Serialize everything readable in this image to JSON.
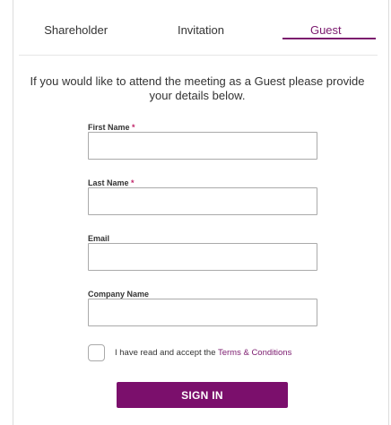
{
  "tabs": [
    {
      "label": "Shareholder",
      "active": false
    },
    {
      "label": "Invitation",
      "active": false
    },
    {
      "label": "Guest",
      "active": true
    }
  ],
  "intro": "If you would like to attend the meeting as a Guest please provide your details below.",
  "form": {
    "first_name": {
      "label": "First Name",
      "required_mark": "*",
      "value": ""
    },
    "last_name": {
      "label": "Last Name",
      "required_mark": "*",
      "value": ""
    },
    "email": {
      "label": "Email",
      "value": ""
    },
    "company": {
      "label": "Company Name",
      "value": ""
    }
  },
  "terms": {
    "checked": false,
    "text": "I have read and accept the ",
    "link": "Terms & Conditions"
  },
  "submit_label": "SIGN IN",
  "colors": {
    "accent": "#7b1a6e",
    "button": "#7b0f6c",
    "required": "#c0266a"
  }
}
